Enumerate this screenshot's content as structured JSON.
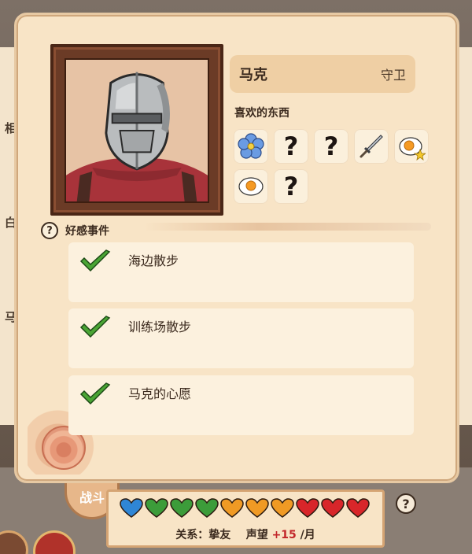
{
  "character": {
    "name": "马克",
    "role": "守卫"
  },
  "likes": {
    "title": "喜欢的东西",
    "items": [
      {
        "icon": "blue-flower-icon",
        "known": true
      },
      {
        "icon": "unknown-item-icon",
        "known": false,
        "text": "?"
      },
      {
        "icon": "unknown-item-icon",
        "known": false,
        "text": "?"
      },
      {
        "icon": "dagger-icon",
        "known": true
      },
      {
        "icon": "fried-egg-star-icon",
        "known": true
      },
      {
        "icon": "fried-egg-icon",
        "known": true
      },
      {
        "icon": "unknown-item-icon",
        "known": false,
        "text": "?"
      }
    ]
  },
  "affection": {
    "help": "?",
    "title": "好感事件",
    "events": [
      {
        "label": "海边散步",
        "completed": true
      },
      {
        "label": "训练场散步",
        "completed": true
      },
      {
        "label": "马克的心愿",
        "completed": true
      }
    ]
  },
  "relationship": {
    "hearts": [
      "blue",
      "green",
      "green",
      "green",
      "orange",
      "orange",
      "orange",
      "red",
      "red",
      "red"
    ],
    "label": "关系：",
    "status": "挚友",
    "reputation_label": "声望",
    "reputation_value": "+15",
    "reputation_unit": "/月",
    "help": "?"
  },
  "background": {
    "battle_tab": "战斗",
    "left_fragments": [
      "相",
      "白",
      "马"
    ]
  },
  "colors": {
    "heart_blue": "#2f86d6",
    "heart_green": "#3c9c3a",
    "heart_orange": "#f09a24",
    "heart_red": "#d8262a",
    "panel_bg": "#f8e4c6",
    "accent_check": "#3a8a26"
  }
}
